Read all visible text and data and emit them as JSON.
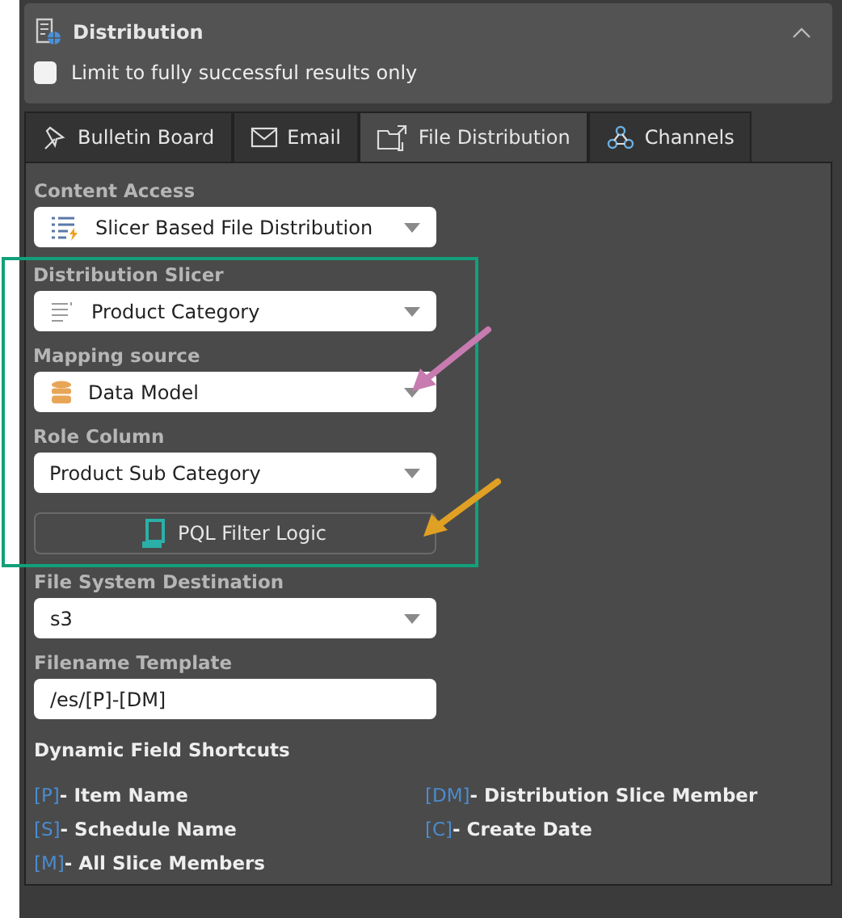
{
  "section": {
    "title": "Distribution",
    "expanded": true
  },
  "limit_checkbox": {
    "label": "Limit to fully successful results only",
    "checked": false
  },
  "tabs": [
    {
      "label": "Bulletin Board",
      "selected": false
    },
    {
      "label": "Email",
      "selected": false
    },
    {
      "label": "File Distribution",
      "selected": true
    },
    {
      "label": "Channels",
      "selected": false
    }
  ],
  "field_groups": [
    {
      "framed": false,
      "fields": [
        {
          "kind": "select",
          "label": "Content Access",
          "value": "Slicer Based File Distribution"
        }
      ]
    },
    {
      "framed": true,
      "fields": [
        {
          "kind": "select",
          "label": "Distribution Slicer",
          "value": "Product Category"
        },
        {
          "kind": "select",
          "label": "Mapping source",
          "value": "Data Model"
        },
        {
          "kind": "select",
          "label": "Role Column",
          "value": "Product Sub Category"
        },
        {
          "kind": "button",
          "label": "PQL Filter Logic"
        }
      ]
    },
    {
      "framed": false,
      "fields": [
        {
          "kind": "select",
          "label": "File System Destination",
          "value": "s3"
        },
        {
          "kind": "text",
          "label": "Filename Template",
          "value": "/es/[P]-[DM]"
        }
      ]
    }
  ],
  "shortcuts": {
    "title": "Dynamic Field Shortcuts",
    "items": [
      {
        "code": "[P]",
        "label": "- Item Name"
      },
      {
        "code": "[DM]",
        "label": "- Distribution Slice Member"
      },
      {
        "code": "[S]",
        "label": "- Schedule Name"
      },
      {
        "code": "[C]",
        "label": "- Create Date"
      },
      {
        "code": "[M]",
        "label": "- All Slice Members"
      }
    ]
  }
}
